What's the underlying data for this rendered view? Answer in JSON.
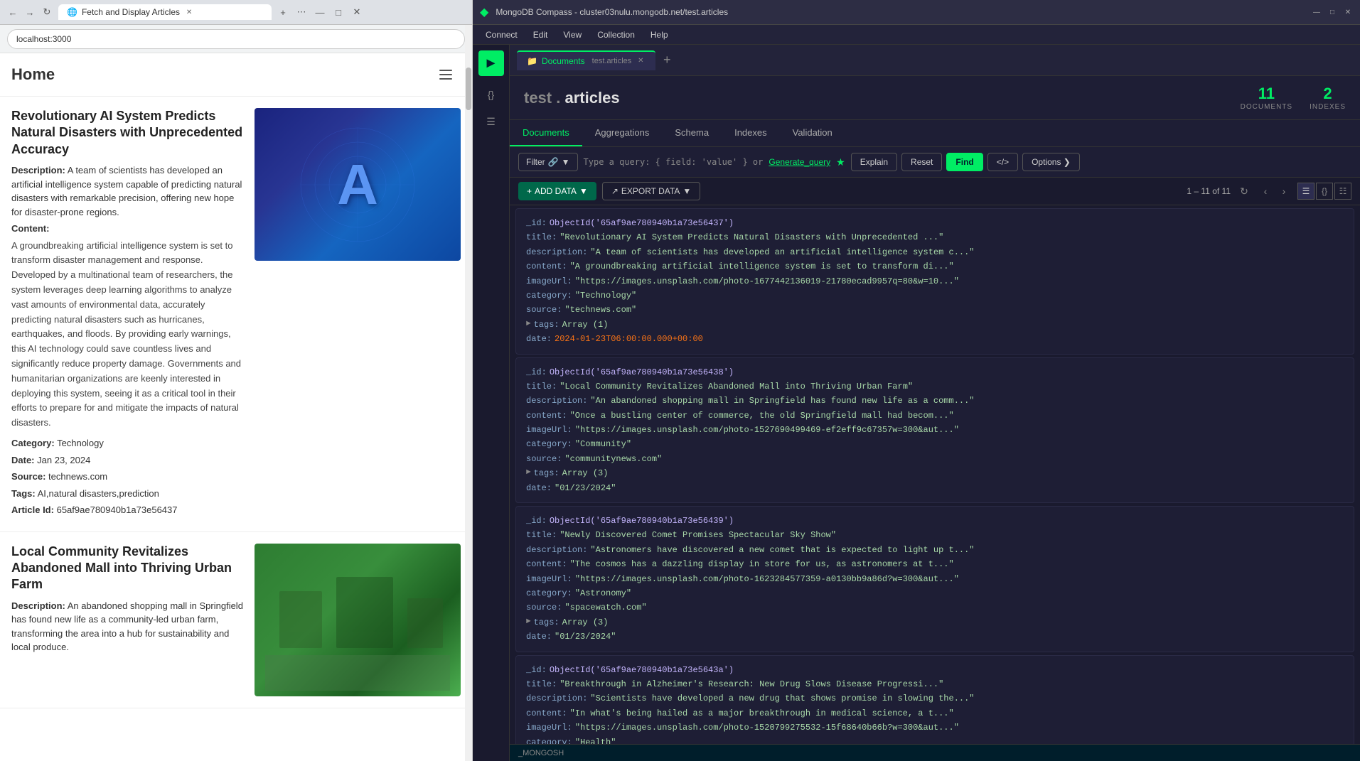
{
  "browser": {
    "tab_title": "Fetch and Display Articles",
    "address": "localhost:3000",
    "home_title": "Home",
    "articles": [
      {
        "title": "Revolutionary AI System Predicts Natural Disasters with Unprecedented Accuracy",
        "description_label": "Description:",
        "description": "A team of scientists has developed an artificial intelligence system capable of predicting natural disasters with remarkable precision, offering new hope for disaster-prone regions.",
        "content_label": "Content:",
        "content": "A groundbreaking artificial intelligence system is set to transform disaster management and response. Developed by a multinational team of researchers, the system leverages deep learning algorithms to analyze vast amounts of environmental data, accurately predicting natural disasters such as hurricanes, earthquakes, and floods. By providing early warnings, this AI technology could save countless lives and significantly reduce property damage. Governments and humanitarian organizations are keenly interested in deploying this system, seeing it as a critical tool in their efforts to prepare for and mitigate the impacts of natural disasters.",
        "category_label": "Category:",
        "category": "Technology",
        "date_label": "Date:",
        "date": "Jan 23, 2024",
        "source_label": "Source:",
        "source": "technews.com",
        "tags_label": "Tags:",
        "tags": "AI,natural disasters,prediction",
        "article_id_label": "Article Id:",
        "article_id": "65af9ae780940b1a73e56437",
        "image_type": "ai"
      },
      {
        "title": "Local Community Revitalizes Abandoned Mall into Thriving Urban Farm",
        "description_label": "Description:",
        "description": "An abandoned shopping mall in Springfield has found new life as a community-led urban farm, transforming the area into a hub for sustainability and local produce.",
        "image_type": "urban_farm"
      }
    ]
  },
  "compass": {
    "title": "MongoDB Compass - cluster03nulu.mongodb.net/test.articles",
    "menu": {
      "connect": "Connect",
      "edit": "Edit",
      "view": "View",
      "collection": "Collection",
      "help": "Help"
    },
    "tab": {
      "label": "Documents",
      "collection": "test.articles"
    },
    "collection": {
      "db": "test",
      "separator": ".",
      "name": "articles",
      "documents_count": "11",
      "documents_label": "DOCUMENTS",
      "indexes_count": "2",
      "indexes_label": "INDEXES"
    },
    "tabs": [
      "Documents",
      "Aggregations",
      "Schema",
      "Indexes",
      "Validation"
    ],
    "active_tab": "Documents",
    "query_bar": {
      "filter_label": "Filter",
      "placeholder": "Type a query: { field: 'value' } or",
      "generate_query": "Generate_query",
      "explain": "Explain",
      "reset": "Reset",
      "find": "Find",
      "options": "Options"
    },
    "toolbar": {
      "add_data": "ADD DATA",
      "export_data": "EXPORT DATA",
      "pagination": "1 – 11 of 11"
    },
    "documents": [
      {
        "id": "ObjectId('65af9ae780940b1a73e56437')",
        "title": "\"Revolutionary AI System Predicts Natural Disasters with Unprecedented ...\"",
        "description": "\"A team of scientists has developed an artificial intelligence system c...\"",
        "content": "\"A groundbreaking artificial intelligence system is set to transform di...\"",
        "imageUrl": "\"https://images.unsplash.com/photo-1677442136019-21780ecad9957q=80&w=10...\"",
        "category": "\"Technology\"",
        "source": "\"technews.com\"",
        "tags": "Array (1)",
        "date": "2024-01-23T06:00:00.000+00:00"
      },
      {
        "id": "ObjectId('65af9ae780940b1a73e56438')",
        "title": "\"Local Community Revitalizes Abandoned Mall into Thriving Urban Farm\"",
        "description": "\"An abandoned shopping mall in Springfield has found new life as a comm...\"",
        "content": "\"Once a bustling center of commerce, the old Springfield mall had becom...\"",
        "imageUrl": "\"https://images.unsplash.com/photo-1527690499469-ef2eff9c67357w=300&aut...\"",
        "category": "\"Community\"",
        "source": "\"communitynews.com\"",
        "tags": "Array (3)",
        "date": "\"01/23/2024\""
      },
      {
        "id": "ObjectId('65af9ae780940b1a73e56439')",
        "title": "\"Newly Discovered Comet Promises Spectacular Sky Show\"",
        "description": "\"Astronomers have discovered a new comet that is expected to light up t...\"",
        "content": "\"The cosmos has a dazzling display in store for us, as astronomers at t...\"",
        "imageUrl": "\"https://images.unsplash.com/photo-1623284577359-a0130bb9a86d?w=300&aut...\"",
        "category": "\"Astronomy\"",
        "source": "\"spacewatch.com\"",
        "tags": "Array (3)",
        "date": "\"01/23/2024\""
      },
      {
        "id": "ObjectId('65af9ae780940b1a73e5643a')",
        "title": "\"Breakthrough in Alzheimer's Research: New Drug Slows Disease Progressi...\"",
        "description": "\"Scientists have developed a new drug that shows promise in slowing the...\"",
        "content": "\"In what's being hailed as a major breakthrough in medical science, a t...\"",
        "imageUrl": "\"https://images.unsplash.com/photo-1520799275532-15f68640b66b?w=300&aut...\"",
        "category": "\"Health\""
      }
    ],
    "status_bar": "_MONGOSH"
  }
}
